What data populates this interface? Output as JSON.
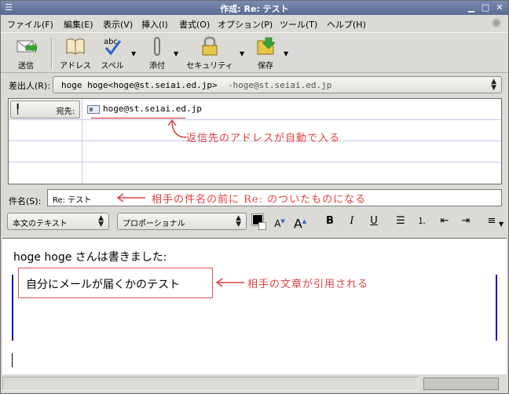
{
  "window": {
    "title": "作成: Re: テスト"
  },
  "menubar": [
    "ファイル(F)",
    "編集(E)",
    "表示(V)",
    "挿入(I)",
    "書式(O)",
    "オプション(P)",
    "ツール(T)",
    "ヘルプ(H)"
  ],
  "toolbar": {
    "send": "送信",
    "address": "アドレス",
    "spell": "スペル",
    "spell_icon_text": "abc",
    "attach": "添付",
    "security": "セキュリティ",
    "save": "保存"
  },
  "from": {
    "label": "差出人(R):",
    "value": "hoge hoge<hoge@st.seiai.ed.jp>",
    "suffix": "-hoge@st.seiai.ed.jp"
  },
  "recipients": {
    "to_label": "宛先:",
    "to_address": "hoge@st.seiai.ed.jp"
  },
  "subject": {
    "label": "件名(S):",
    "value": "Re: テスト"
  },
  "format": {
    "paragraph_style": "本文のテキスト",
    "font": "プロポーショナル",
    "bold": "B",
    "italic": "I",
    "underline": "U"
  },
  "editor": {
    "quote_header": "hoge hoge さんは書きました:",
    "quoted_text": "自分にメールが届くかのテスト"
  },
  "annotations": {
    "address_note": "返信先のアドレスが自動で入る",
    "subject_note": "相手の件名の前に Re: のついたものになる",
    "quote_note": "相手の文章が引用される"
  },
  "colors": {
    "annotation": "#e34040",
    "quote_bar": "#1010c0",
    "titlebar": "#5a6a94"
  }
}
